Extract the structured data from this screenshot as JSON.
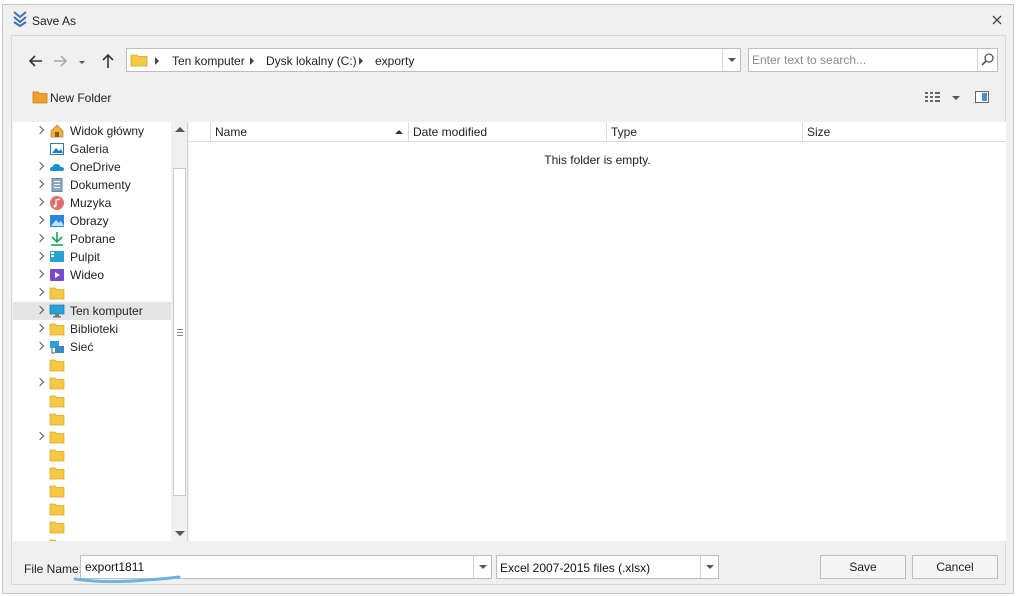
{
  "window": {
    "title": "Save As"
  },
  "address_bar": {
    "breadcrumbs": [
      "Ten komputer",
      "Dysk lokalny (C:)",
      "exporty"
    ]
  },
  "search": {
    "placeholder": "Enter text to search..."
  },
  "toolbar": {
    "new_folder_label": "New Folder"
  },
  "sidebar": {
    "items": [
      {
        "label": "Widok główny",
        "icon": "home-icon",
        "expandable": true
      },
      {
        "label": "Galeria",
        "icon": "gallery-icon",
        "expandable": false
      },
      {
        "label": "OneDrive",
        "icon": "cloud-icon",
        "expandable": true
      },
      {
        "label": "Dokumenty",
        "icon": "documents-icon",
        "expandable": true
      },
      {
        "label": "Muzyka",
        "icon": "music-icon",
        "expandable": true
      },
      {
        "label": "Obrazy",
        "icon": "pictures-icon",
        "expandable": true
      },
      {
        "label": "Pobrane",
        "icon": "download-icon",
        "expandable": true
      },
      {
        "label": "Pulpit",
        "icon": "desktop-icon",
        "expandable": true
      },
      {
        "label": "Wideo",
        "icon": "video-icon",
        "expandable": true
      },
      {
        "label": "",
        "icon": "folder-icon",
        "expandable": true
      },
      {
        "label": "Ten komputer",
        "icon": "computer-icon",
        "expandable": true,
        "selected": true
      },
      {
        "label": "Biblioteki",
        "icon": "folder-icon",
        "expandable": true
      },
      {
        "label": "Sieć",
        "icon": "network-icon",
        "expandable": true
      },
      {
        "label": "",
        "icon": "folder-icon",
        "expandable": false
      },
      {
        "label": "",
        "icon": "folder-icon",
        "expandable": true
      },
      {
        "label": "",
        "icon": "folder-icon",
        "expandable": false
      },
      {
        "label": "",
        "icon": "folder-icon",
        "expandable": false
      },
      {
        "label": "",
        "icon": "folder-icon",
        "expandable": true
      },
      {
        "label": "",
        "icon": "folder-icon",
        "expandable": false
      },
      {
        "label": "",
        "icon": "folder-icon",
        "expandable": false
      },
      {
        "label": "",
        "icon": "folder-icon",
        "expandable": false
      },
      {
        "label": "",
        "icon": "folder-icon",
        "expandable": false
      },
      {
        "label": "",
        "icon": "folder-icon",
        "expandable": false
      },
      {
        "label": "",
        "icon": "folder-icon",
        "expandable": false
      }
    ]
  },
  "file_list": {
    "columns": [
      "Name",
      "Date modified",
      "Type",
      "Size"
    ],
    "sorted_column": "Name",
    "empty_message": "This folder is empty."
  },
  "footer": {
    "file_name_label": "File Name:",
    "file_name_value": "export1811",
    "file_type_value": "Excel 2007-2015 files (.xlsx)",
    "save_label": "Save",
    "cancel_label": "Cancel"
  },
  "colors": {
    "folder_yellow": "#f6c945",
    "accent_blue": "#1e8fd6",
    "underline_annotation": "#6fb3e0"
  }
}
